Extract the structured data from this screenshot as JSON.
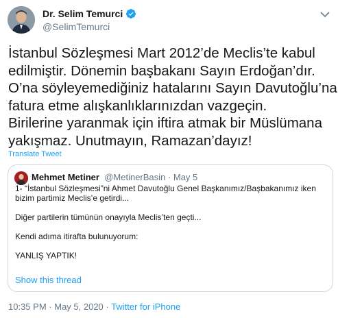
{
  "author": {
    "display_name": "Dr. Selim Temurci",
    "handle": "@SelimTemurci",
    "verified": true
  },
  "tweet": {
    "lines": [
      "İstanbul Sözleşmesi Mart 2012’de Meclis’te kabul",
      "edilmiştir. Dönemin başbakanı Sayın Erdoğan’dır.",
      "O’na söyleyemediğiniz hatalarını Sayın Davutoğlu’na",
      "fatura etme alışkanlıklarınızdan vazgeçin.",
      "Birilerine yaranmak için iftira atmak bir Müslümana",
      "yakışmaz. Unutmayın, Ramazan’dayız!"
    ],
    "translate_label": "Translate Tweet"
  },
  "quoted": {
    "display_name": "Mehmet Metiner",
    "handle": "@MetinerBasin",
    "date": "May 5",
    "lines": [
      "1- “İstanbul Sözleşmesi”ni Ahmet Davutoğlu Genel Başkanımız/Başbakanımız iken",
      "bizim partimiz Meclis’e getirdi...",
      "",
      "Diğer partilerin tümünün onayıyla Meclis’ten geçti...",
      "",
      "Kendi adıma itirafta bulunuyorum:",
      "",
      "YANLIŞ YAPTIK!"
    ],
    "show_thread_label": "Show this thread"
  },
  "meta": {
    "time": "10:35 PM",
    "date": "May 5, 2020",
    "source": "Twitter for iPhone"
  },
  "colors": {
    "link": "#1da1f2",
    "secondary": "#657786",
    "text": "#14171a",
    "border": "#ccd6dd"
  }
}
